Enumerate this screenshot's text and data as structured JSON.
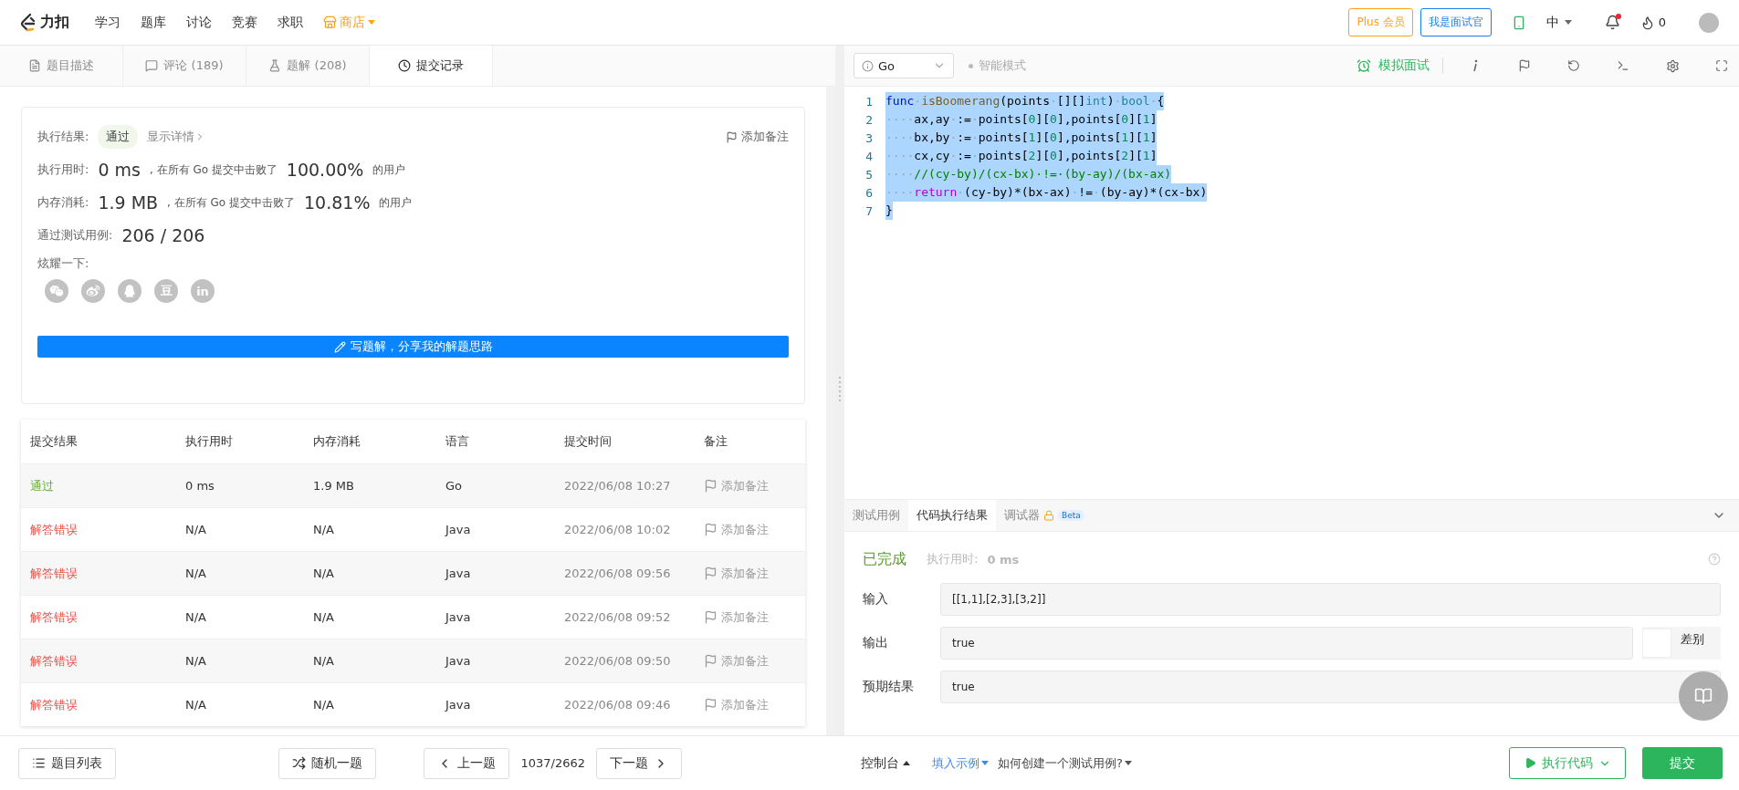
{
  "nav": {
    "logo": "力扣",
    "items": [
      "学习",
      "题库",
      "讨论",
      "竞赛",
      "求职"
    ],
    "store": "商店",
    "plus": "Plus 会员",
    "interviewer": "我是面试官",
    "lang": "中",
    "fire_count": "0"
  },
  "left_tabs": [
    {
      "label": "题目描述",
      "selected": false
    },
    {
      "label": "评论 (189)",
      "selected": false
    },
    {
      "label": "题解 (208)",
      "selected": false
    },
    {
      "label": "提交记录",
      "selected": true
    }
  ],
  "result_card": {
    "result_label": "执行结果:",
    "result_badge": "通过",
    "details_link": "显示详情",
    "add_note": "添加备注",
    "stats": [
      {
        "label": "执行用时:",
        "value": "0 ms",
        "middle": ", 在所有 Go 提交中击败了",
        "percent": "100.00%",
        "tail": "的用户"
      },
      {
        "label": "内存消耗:",
        "value": "1.9 MB",
        "middle": ", 在所有 Go 提交中击败了",
        "percent": "10.81%",
        "tail": "的用户"
      }
    ],
    "cases_label": "通过测试用例:",
    "cases_value": "206 / 206",
    "share_label": "炫耀一下:",
    "share": [
      {
        "kind": "wechat"
      },
      {
        "kind": "weibo"
      },
      {
        "kind": "qq"
      },
      {
        "kind": "glyph",
        "label": "豆"
      },
      {
        "kind": "glyph",
        "label": "in"
      }
    ],
    "write_button": "写题解，分享我的解题思路"
  },
  "table": {
    "columns": [
      "提交结果",
      "执行用时",
      "内存消耗",
      "语言",
      "提交时间",
      "备注"
    ],
    "rows": [
      {
        "status": "通过",
        "kind": "accepted",
        "time": "0 ms",
        "memory": "1.9 MB",
        "language": "Go",
        "submitted": "2022/06/08 10:27",
        "note": "添加备注"
      },
      {
        "status": "解答错误",
        "kind": "error",
        "time": "N/A",
        "memory": "N/A",
        "language": "Java",
        "submitted": "2022/06/08 10:02",
        "note": "添加备注"
      },
      {
        "status": "解答错误",
        "kind": "error",
        "time": "N/A",
        "memory": "N/A",
        "language": "Java",
        "submitted": "2022/06/08 09:56",
        "note": "添加备注"
      },
      {
        "status": "解答错误",
        "kind": "error",
        "time": "N/A",
        "memory": "N/A",
        "language": "Java",
        "submitted": "2022/06/08 09:52",
        "note": "添加备注"
      },
      {
        "status": "解答错误",
        "kind": "error",
        "time": "N/A",
        "memory": "N/A",
        "language": "Java",
        "submitted": "2022/06/08 09:50",
        "note": "添加备注"
      },
      {
        "status": "解答错误",
        "kind": "error",
        "time": "N/A",
        "memory": "N/A",
        "language": "Java",
        "submitted": "2022/06/08 09:46",
        "note": "添加备注"
      }
    ]
  },
  "editor_toolbar": {
    "language": "Go",
    "smart_mode": "智能模式",
    "mock_interview": "模拟面试"
  },
  "code": [
    {
      "number": "1",
      "selected": true,
      "tokens": [
        {
          "kind": "kw",
          "text": "func"
        },
        {
          "kind": "ws",
          "text": "·"
        },
        {
          "kind": "fn",
          "text": "isBoomerang"
        },
        {
          "kind": "plain",
          "text": "(points"
        },
        {
          "kind": "ws",
          "text": "·"
        },
        {
          "kind": "plain",
          "text": "[][]"
        },
        {
          "kind": "type",
          "text": "int"
        },
        {
          "kind": "plain",
          "text": ")"
        },
        {
          "kind": "ws",
          "text": "·"
        },
        {
          "kind": "type",
          "text": "bool"
        },
        {
          "kind": "ws",
          "text": "·"
        },
        {
          "kind": "plain",
          "text": "{"
        }
      ]
    },
    {
      "number": "2",
      "selected": true,
      "tokens": [
        {
          "kind": "ws",
          "text": "····"
        },
        {
          "kind": "plain",
          "text": "ax,ay"
        },
        {
          "kind": "ws",
          "text": "·"
        },
        {
          "kind": "plain",
          "text": ":="
        },
        {
          "kind": "ws",
          "text": "·"
        },
        {
          "kind": "plain",
          "text": "points["
        },
        {
          "kind": "num",
          "text": "0"
        },
        {
          "kind": "plain",
          "text": "]["
        },
        {
          "kind": "num",
          "text": "0"
        },
        {
          "kind": "plain",
          "text": "],points["
        },
        {
          "kind": "num",
          "text": "0"
        },
        {
          "kind": "plain",
          "text": "]["
        },
        {
          "kind": "num",
          "text": "1"
        },
        {
          "kind": "plain",
          "text": "]"
        }
      ]
    },
    {
      "number": "3",
      "selected": true,
      "tokens": [
        {
          "kind": "ws",
          "text": "····"
        },
        {
          "kind": "plain",
          "text": "bx,by"
        },
        {
          "kind": "ws",
          "text": "·"
        },
        {
          "kind": "plain",
          "text": ":="
        },
        {
          "kind": "ws",
          "text": "·"
        },
        {
          "kind": "plain",
          "text": "points["
        },
        {
          "kind": "num",
          "text": "1"
        },
        {
          "kind": "plain",
          "text": "]["
        },
        {
          "kind": "num",
          "text": "0"
        },
        {
          "kind": "plain",
          "text": "],points["
        },
        {
          "kind": "num",
          "text": "1"
        },
        {
          "kind": "plain",
          "text": "]["
        },
        {
          "kind": "num",
          "text": "1"
        },
        {
          "kind": "plain",
          "text": "]"
        }
      ]
    },
    {
      "number": "4",
      "selected": true,
      "tokens": [
        {
          "kind": "ws",
          "text": "····"
        },
        {
          "kind": "plain",
          "text": "cx,cy"
        },
        {
          "kind": "ws",
          "text": "·"
        },
        {
          "kind": "plain",
          "text": ":="
        },
        {
          "kind": "ws",
          "text": "·"
        },
        {
          "kind": "plain",
          "text": "points["
        },
        {
          "kind": "num",
          "text": "2"
        },
        {
          "kind": "plain",
          "text": "]["
        },
        {
          "kind": "num",
          "text": "0"
        },
        {
          "kind": "plain",
          "text": "],points["
        },
        {
          "kind": "num",
          "text": "2"
        },
        {
          "kind": "plain",
          "text": "]["
        },
        {
          "kind": "num",
          "text": "1"
        },
        {
          "kind": "plain",
          "text": "]"
        }
      ]
    },
    {
      "number": "5",
      "selected": true,
      "tokens": [
        {
          "kind": "ws",
          "text": "····"
        },
        {
          "kind": "comment",
          "text": "//(cy-by)/(cx-bx)·!=·(by-ay)/(bx-ax)"
        }
      ]
    },
    {
      "number": "6",
      "selected": true,
      "tokens": [
        {
          "kind": "ws",
          "text": "····"
        },
        {
          "kind": "kw2",
          "text": "return"
        },
        {
          "kind": "ws",
          "text": "·"
        },
        {
          "kind": "plain",
          "text": "(cy-by)*(bx-ax)"
        },
        {
          "kind": "ws",
          "text": "·"
        },
        {
          "kind": "plain",
          "text": "!="
        },
        {
          "kind": "ws",
          "text": "·"
        },
        {
          "kind": "plain",
          "text": "(by-ay)*(cx-bx)"
        }
      ]
    },
    {
      "number": "7",
      "selected": true,
      "tokens": [
        {
          "kind": "plain",
          "text": "}"
        }
      ]
    }
  ],
  "console_tabs": [
    {
      "label": "测试用例",
      "selected": false
    },
    {
      "label": "代码执行结果",
      "selected": true
    },
    {
      "label": "调试器",
      "selected": false,
      "badge": "Beta",
      "locked": true
    }
  ],
  "run_result": {
    "status": "已完成",
    "time_label": "执行用时:",
    "time_value": "0 ms",
    "fields": [
      {
        "label": "输入",
        "value": "[[1,1],[2,3],[3,2]]"
      },
      {
        "label": "输出",
        "value": "true",
        "diff_label": "差别",
        "diff_on": false
      },
      {
        "label": "预期结果",
        "value": "true"
      }
    ]
  },
  "bottom_left": {
    "problem_list": "题目列表",
    "random": "随机一题",
    "prev": "上一题",
    "counter": "1037/2662",
    "next": "下一题"
  },
  "bottom_right": {
    "console": "控制台",
    "fill_example": "填入示例",
    "how_to": "如何创建一个测试用例?",
    "run": "执行代码",
    "submit": "提交"
  }
}
